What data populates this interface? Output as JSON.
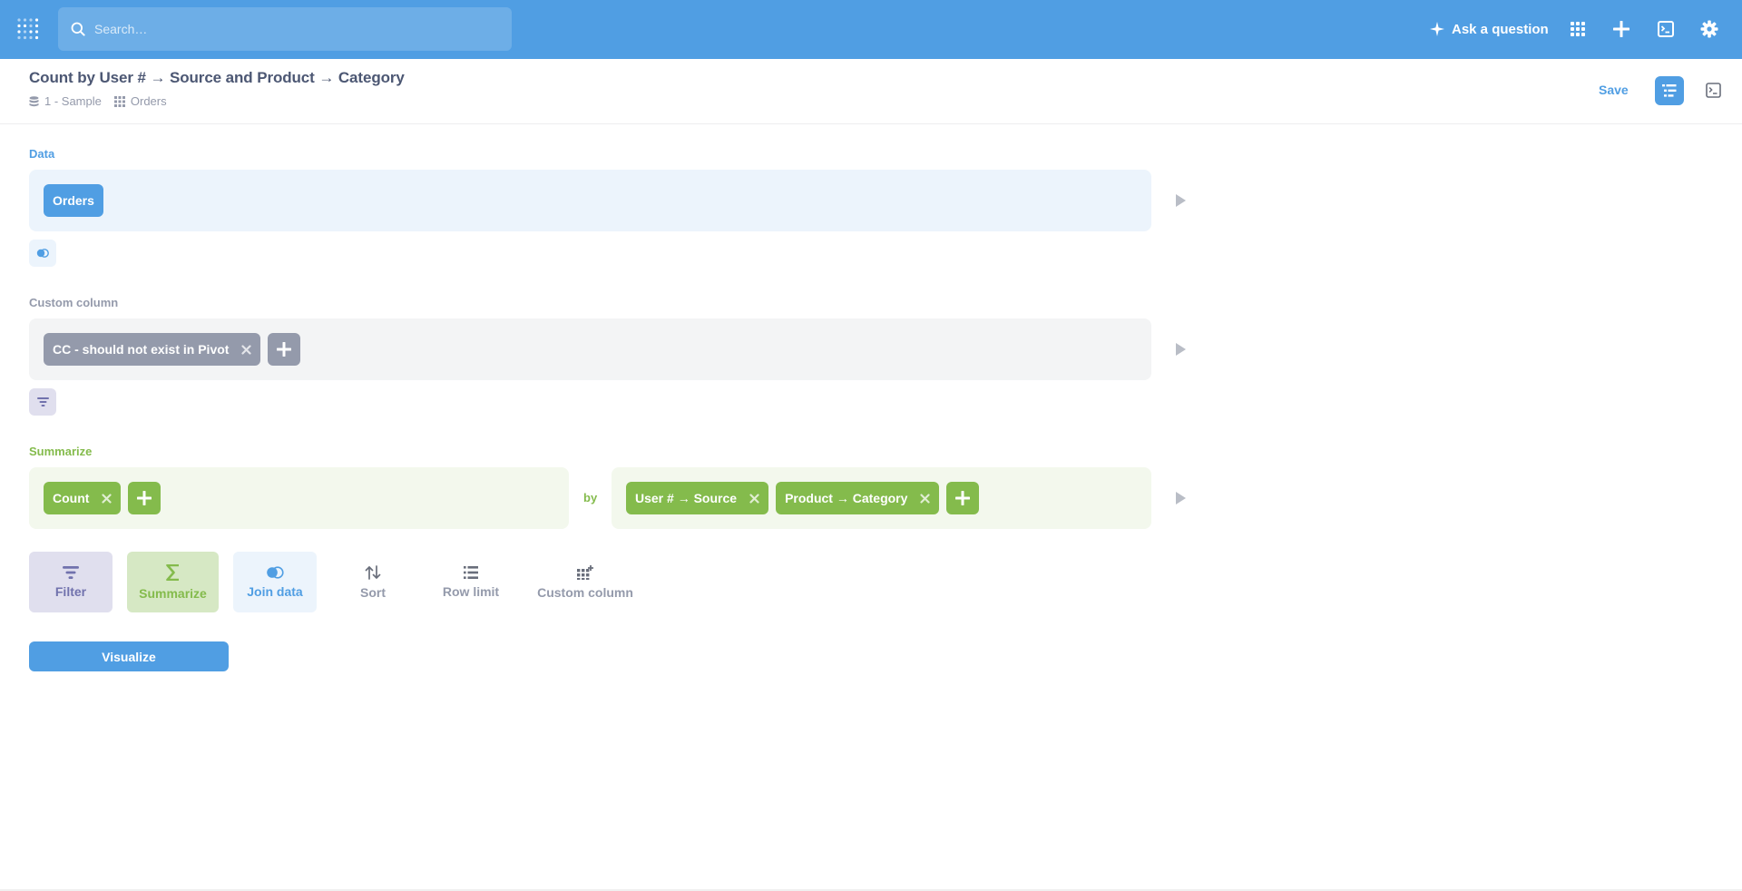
{
  "nav": {
    "search_placeholder": "Search…",
    "ask_label": "Ask a question"
  },
  "question": {
    "title": "Count by User # → Source and Product → Category",
    "database": "1 - Sample",
    "table": "Orders",
    "save_label": "Save"
  },
  "steps": {
    "data": {
      "label": "Data",
      "source": "Orders"
    },
    "custom_column": {
      "label": "Custom column",
      "columns": [
        "CC - should not exist in Pivot"
      ]
    },
    "summarize": {
      "label": "Summarize",
      "metrics": [
        "Count"
      ],
      "by_label": "by",
      "breakouts": [
        "User # → Source",
        "Product → Category"
      ]
    }
  },
  "actions": {
    "filter": "Filter",
    "summarize": "Summarize",
    "join": "Join data",
    "sort": "Sort",
    "limit": "Row limit",
    "custom_column": "Custom column"
  },
  "visualize_label": "Visualize",
  "colors": {
    "brand": "#509ee3",
    "filter": "#7172ad",
    "summarize": "#84bb4c",
    "custom_column_pill": "#949aab"
  }
}
